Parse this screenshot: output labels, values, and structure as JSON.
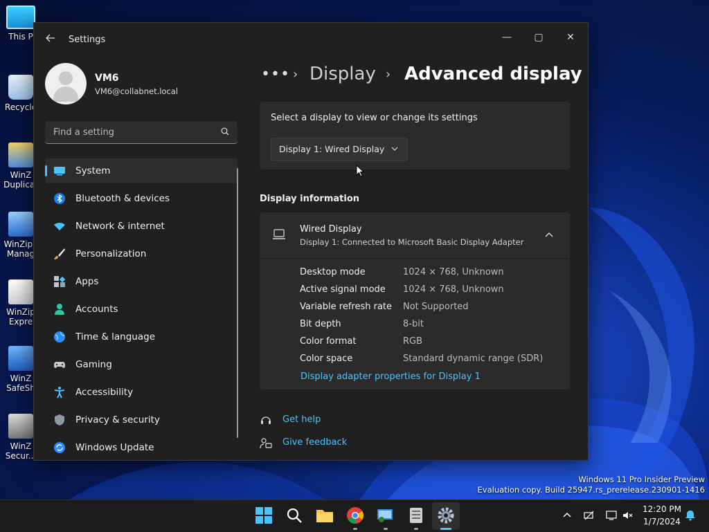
{
  "desktop": {
    "icons": [
      {
        "label": "This P",
        "icon": "this-pc-icon"
      },
      {
        "label": "Recycle",
        "icon": "recycle-bin-icon"
      },
      {
        "label": "WinZ\nDuplicat",
        "icon": "winzip-duplicate-icon"
      },
      {
        "label": "WinZip I\nManag",
        "icon": "winzip-image-manager-icon"
      },
      {
        "label": "WinZip\nExpre",
        "icon": "winzip-pdf-express-icon"
      },
      {
        "label": "WinZ\nSafeSh",
        "icon": "winzip-safeshare-icon"
      },
      {
        "label": "WinZ\nSecur...",
        "icon": "winzip-secure-icon"
      }
    ],
    "watermark_line1": "Windows 11 Pro Insider Preview",
    "watermark_line2": "Evaluation copy. Build 25947.rs_prerelease.230901-1416"
  },
  "window": {
    "title": "Settings",
    "controls": {
      "minimize": "—",
      "maximize": "▢",
      "close": "✕"
    }
  },
  "profile": {
    "name": "VM6",
    "email": "VM6@collabnet.local"
  },
  "search": {
    "placeholder": "Find a setting"
  },
  "nav": {
    "items": [
      {
        "label": "System",
        "icon": "system-icon",
        "active": true
      },
      {
        "label": "Bluetooth & devices",
        "icon": "bluetooth-icon"
      },
      {
        "label": "Network & internet",
        "icon": "wifi-icon"
      },
      {
        "label": "Personalization",
        "icon": "brush-icon"
      },
      {
        "label": "Apps",
        "icon": "apps-icon"
      },
      {
        "label": "Accounts",
        "icon": "accounts-icon"
      },
      {
        "label": "Time & language",
        "icon": "globe-icon"
      },
      {
        "label": "Gaming",
        "icon": "gamepad-icon"
      },
      {
        "label": "Accessibility",
        "icon": "accessibility-icon"
      },
      {
        "label": "Privacy & security",
        "icon": "shield-icon"
      },
      {
        "label": "Windows Update",
        "icon": "update-icon"
      }
    ]
  },
  "breadcrumb": {
    "more": "•••",
    "sep": "›",
    "parent": "Display",
    "current": "Advanced display"
  },
  "select_display": {
    "label": "Select a display to view or change its settings",
    "value": "Display 1: Wired Display"
  },
  "display_info": {
    "section_title": "Display information",
    "device_name": "Wired Display",
    "device_sub": "Display 1: Connected to Microsoft Basic Display Adapter",
    "rows": [
      {
        "key": "Desktop mode",
        "value": "1024 × 768, Unknown"
      },
      {
        "key": "Active signal mode",
        "value": "1024 × 768, Unknown"
      },
      {
        "key": "Variable refresh rate",
        "value": "Not Supported"
      },
      {
        "key": "Bit depth",
        "value": "8-bit"
      },
      {
        "key": "Color format",
        "value": "RGB"
      },
      {
        "key": "Color space",
        "value": "Standard dynamic range (SDR)"
      }
    ],
    "adapter_link": "Display adapter properties for Display 1"
  },
  "help": {
    "get_help": "Get help",
    "give_feedback": "Give feedback"
  },
  "taskbar": {
    "time": "12:20 PM",
    "date": "1/7/2024"
  },
  "colors": {
    "accent": "#4cc2ff",
    "window_bg": "#202020",
    "card_bg": "#2b2b2b"
  }
}
